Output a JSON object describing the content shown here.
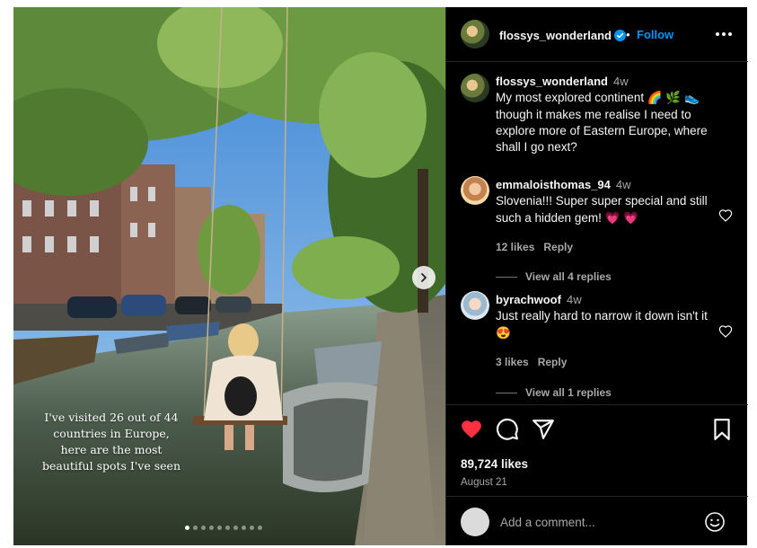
{
  "post": {
    "author": "flossys_wonderland",
    "follow_label": "Follow",
    "header_separator": "•",
    "overlay_text": "I've visited 26 out of 44 countries in Europe, here are the most beautiful spots I've seen",
    "carousel_total": 10,
    "carousel_current": 1
  },
  "caption": {
    "user": "flossys_wonderland",
    "time": "4w",
    "text": "My most explored continent 🌈 🌿 👟 though it makes me realise I need to explore more of Eastern Europe, where shall I go next?"
  },
  "comments": [
    {
      "user": "emmaloisthomas_94",
      "time": "4w",
      "text": "Slovenia!!! Super super special and still such a hidden gem! 💗 💗",
      "likes": "12 likes",
      "reply_label": "Reply",
      "view_replies": "View all 4 replies"
    },
    {
      "user": "byrachwoof",
      "time": "4w",
      "text": "Just really hard to narrow it down isn't it 😍",
      "likes": "3 likes",
      "reply_label": "Reply",
      "view_replies": "View all 1 replies"
    }
  ],
  "stats": {
    "likes": "89,724 likes",
    "date": "August 21"
  },
  "composer": {
    "placeholder": "Add a comment..."
  },
  "colors": {
    "background": "#000000",
    "accent": "#0095f6",
    "like_red": "#ff3040",
    "muted_text": "#a8a8a8"
  },
  "icons": [
    "verified-icon",
    "more-icon",
    "heart-icon",
    "comment-icon",
    "share-icon",
    "bookmark-icon",
    "emoji-icon",
    "chevron-right-icon"
  ]
}
